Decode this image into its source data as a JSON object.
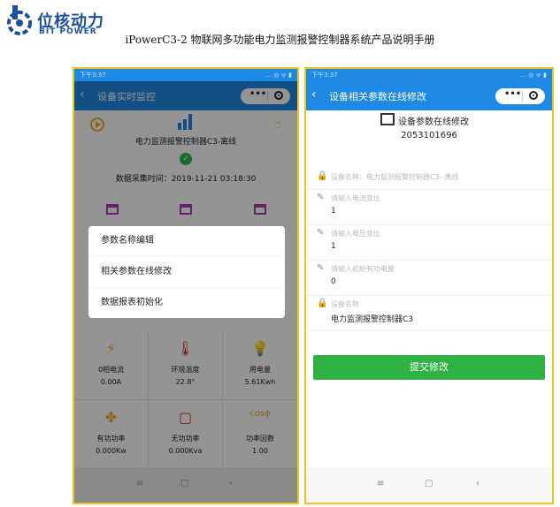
{
  "doc": {
    "logo_cn": "位核动力",
    "logo_en": "BIT POWER",
    "title": "iPowerC3-2 物联网多功能电力监测报警控制器系统产品说明手册"
  },
  "left": {
    "status_time": "下午3:37",
    "status_right": "… ◎ ᯤ ▮",
    "nav_title": "设备实时监控",
    "device_name": "电力监测报警控制器C3-离线",
    "collect_time": "数据采集时间：2019-11-21 03:18:30",
    "menu": [
      "参数名称编辑",
      "相关参数在线修改",
      "数据报表初始化"
    ],
    "grid": [
      {
        "icon": "lightning-icon",
        "label": "0相电流",
        "value": "0.00A",
        "color": "#f5a623"
      },
      {
        "icon": "thermometer-icon",
        "label": "环境温度",
        "value": "22.8°",
        "color": "#d32f2f"
      },
      {
        "icon": "bulb-icon",
        "label": "用电量",
        "value": "5.61Kwh",
        "color": "#1e88e5"
      },
      {
        "icon": "fan-icon",
        "label": "有功功率",
        "value": "0.000Kw",
        "color": "#f5a623"
      },
      {
        "icon": "square-icon",
        "label": "无功功率",
        "value": "0.000Kva",
        "color": "#d32f2f"
      },
      {
        "icon": "cos-icon",
        "label": "功率因数",
        "value": "1.00",
        "color": "#f5a623",
        "glyph": "cosϕ"
      }
    ]
  },
  "right": {
    "status_time": "下午3:37",
    "status_right": "… ◎ ᯤ ▮",
    "nav_title": "设备相关参数在线修改",
    "header_label": "设备参数在线修改",
    "device_id": "2053101696",
    "fields": [
      {
        "icon": "lock-icon",
        "placeholder": "设备名称：电力监测报警控制器C3--离线",
        "value": ""
      },
      {
        "icon": "pencil-icon",
        "placeholder": "请输入电流变比",
        "value": "1"
      },
      {
        "icon": "pencil-icon",
        "placeholder": "请输入电压变比",
        "value": "1"
      },
      {
        "icon": "pencil-icon",
        "placeholder": "请输入初始有功电量",
        "value": "0"
      },
      {
        "icon": "lock-icon",
        "placeholder": "设备名称",
        "value": "电力监测报警控制器C3"
      }
    ],
    "submit_label": "提交修改"
  },
  "nav_bottom": [
    "≡",
    "▢",
    "‹"
  ],
  "colors": {
    "nav_blue": "#1e88e5",
    "submit_green": "#2fb144",
    "frame_yellow": "#f0c419"
  }
}
